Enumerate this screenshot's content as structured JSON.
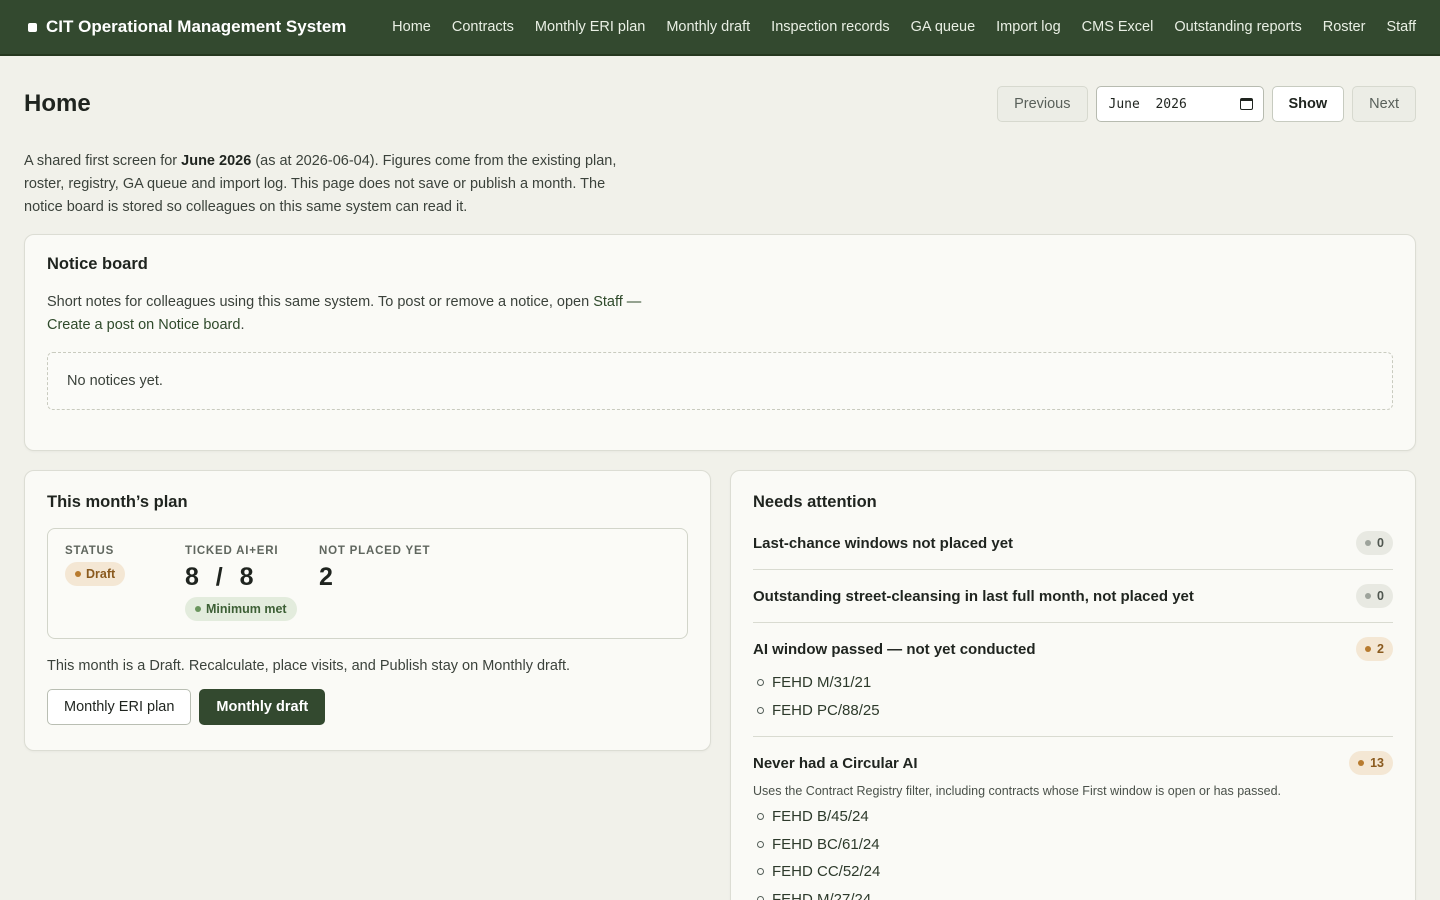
{
  "app": {
    "title": "CIT Operational Management System"
  },
  "nav": [
    "Home",
    "Contracts",
    "Monthly ERI plan",
    "Monthly draft",
    "Inspection records",
    "GA queue",
    "Import log",
    "CMS Excel",
    "Outstanding reports",
    "Roster",
    "Staff"
  ],
  "page": {
    "title": "Home",
    "controls": {
      "previous": "Previous",
      "month_value": "June  2026",
      "show": "Show",
      "next": "Next"
    },
    "intro": {
      "p1": "A shared first screen for ",
      "month": "June 2026",
      "p2": " (as at 2026-06-04). Figures come from the existing plan, roster, registry, GA queue and import log. This page does not save or publish a month. The notice board is stored so colleagues on this same system can read it."
    }
  },
  "notice_board": {
    "title": "Notice board",
    "desc_pre": "Short notes for colleagues using this same system. To post or remove a notice, open ",
    "desc_link": "Staff — Create a post on Notice board",
    "desc_post": ".",
    "empty": "No notices yet."
  },
  "plan": {
    "title": "This month’s plan",
    "status_label": "STATUS",
    "status_value": "Draft",
    "ticked_label": "TICKED AI+ERI",
    "ticked_value": "8  /  8",
    "minimum": "Minimum met",
    "not_placed_label": "NOT PLACED YET",
    "not_placed_value": "2",
    "note": "This month is a Draft. Recalculate, place visits, and Publish stay on Monthly draft.",
    "btn_plan": "Monthly ERI plan",
    "btn_draft": "Monthly draft"
  },
  "attention": {
    "title": "Needs attention",
    "items": [
      {
        "title": "Last-chance windows not placed yet",
        "count": "0",
        "tone": "zero",
        "refs": []
      },
      {
        "title": "Outstanding street-cleansing in last full month, not placed yet",
        "count": "0",
        "tone": "zero",
        "refs": []
      },
      {
        "title": "AI window passed — not yet conducted",
        "count": "2",
        "tone": "warn",
        "refs": [
          "FEHD M/31/21",
          "FEHD PC/88/25"
        ]
      },
      {
        "title": "Never had a Circular AI",
        "count": "13",
        "tone": "warn",
        "sub": "Uses the Contract Registry filter, including contracts whose First window is open or has passed.",
        "refs": [
          "FEHD B/45/24",
          "FEHD BC/61/24",
          "FEHD CC/52/24",
          "FEHD M/27/24"
        ]
      }
    ]
  },
  "colors": {
    "header": "#33492f",
    "background": "#f1f1ea",
    "draft": "#b87b2f",
    "ok": "#6a955d"
  }
}
